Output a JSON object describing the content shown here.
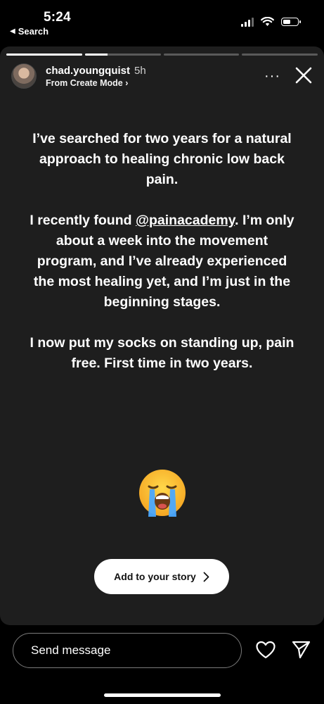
{
  "status_bar": {
    "time": "5:24",
    "back_label": "Search",
    "icons": [
      "signal-icon",
      "wifi-icon",
      "battery-icon"
    ]
  },
  "story": {
    "progress": [
      1.0,
      0.3,
      0.0,
      0.0
    ],
    "username": "chad.youngquist",
    "time_ago": "5h",
    "subtitle": "From Create Mode",
    "subtitle_chevron": "›",
    "more_icon": "more-horizontal-icon",
    "close_icon": "close-icon",
    "text": {
      "p1": "I’ve searched for two years for a natural approach to healing chronic low back pain.",
      "p2_prefix": "I recently found ",
      "p2_mention": "@painacademy",
      "p2_suffix": ". I’m only about a week into the movement program, and I’ve already experienced the most healing yet, and I’m just in the beginning stages.",
      "p3": "I now put my socks on standing up, pain free. First time in two years."
    },
    "emoji": "loudly-crying-face-emoji",
    "add_story_label": "Add to your story"
  },
  "bottom_bar": {
    "message_placeholder": "Send message",
    "heart_icon": "heart-icon",
    "send_icon": "send-icon"
  },
  "colors": {
    "card_background": "#1e1e1e",
    "page_background": "#000000",
    "text": "#ffffff"
  }
}
